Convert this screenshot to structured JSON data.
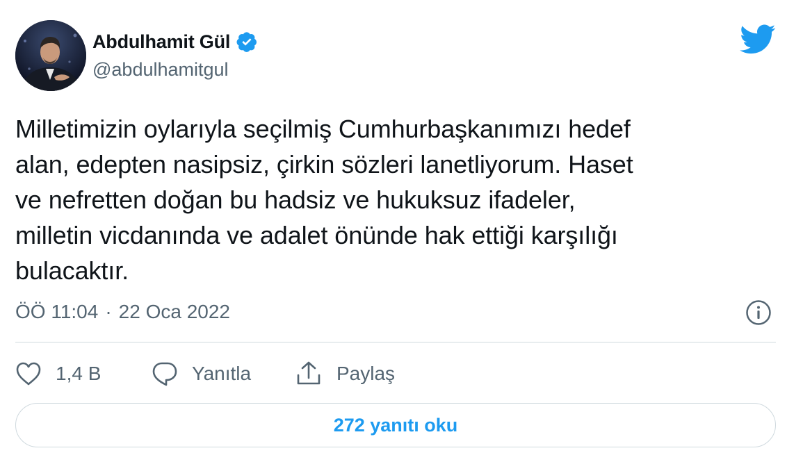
{
  "author": {
    "display_name": "Abdulhamit Gül",
    "handle": "@abdulhamitgul",
    "verified": true,
    "avatar_icon": "profile-photo"
  },
  "tweet": {
    "text": "Milletimizin oylarıyla seçilmiş Cumhurbaşkanımızı hedef\nalan, edepten nasipsiz, çirkin sözleri lanetliyorum. Haset\nve nefretten doğan bu hadsiz ve hukuksuz ifadeler,\nmilletin vicdanında ve adalet önünde hak ettiği karşılığı\nbulacaktır.",
    "time": "ÖÖ 11:04",
    "separator": "·",
    "date": "22 Oca 2022"
  },
  "actions": {
    "like_count": "1,4 B",
    "reply_label": "Yanıtla",
    "share_label": "Paylaş"
  },
  "replies_button": {
    "label": "272 yanıtı oku"
  },
  "icons": {
    "brand": "twitter-bird-icon",
    "verified": "verified-badge-icon",
    "info": "info-icon",
    "like": "heart-icon",
    "reply": "speech-bubble-icon",
    "share": "share-icon"
  },
  "colors": {
    "brand_blue": "#1d9bf0",
    "text_primary": "#0f1419",
    "text_secondary": "#536471",
    "border": "#cfd9de"
  }
}
